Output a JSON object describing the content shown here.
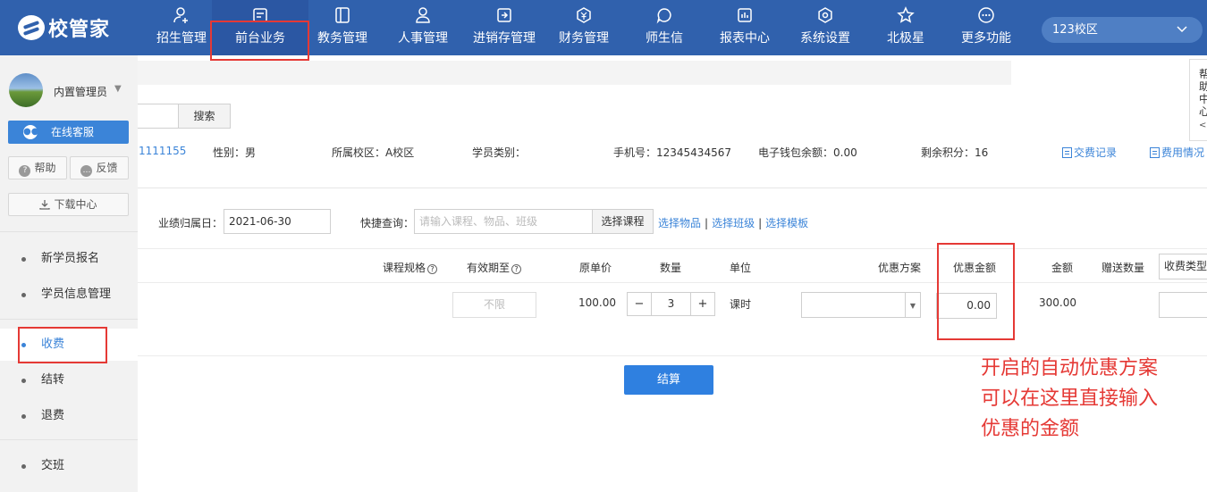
{
  "brand": {
    "logo_text": "校管家"
  },
  "nav": [
    {
      "label": "招生管理",
      "icon": "person-add-icon"
    },
    {
      "label": "前台业务",
      "icon": "front-desk-icon"
    },
    {
      "label": "教务管理",
      "icon": "book-icon"
    },
    {
      "label": "人事管理",
      "icon": "person-icon"
    },
    {
      "label": "进销存管理",
      "icon": "inventory-icon"
    },
    {
      "label": "财务管理",
      "icon": "yuan-icon"
    },
    {
      "label": "师生信",
      "icon": "chat-icon"
    },
    {
      "label": "报表中心",
      "icon": "report-icon"
    },
    {
      "label": "系统设置",
      "icon": "settings-icon"
    },
    {
      "label": "北极星",
      "icon": "star-icon"
    },
    {
      "label": "更多功能",
      "icon": "more-icon"
    }
  ],
  "campus_select": {
    "value": "123校区"
  },
  "sidebar": {
    "user_name": "内置管理员",
    "service_label": "在线客服",
    "help_label": "帮助",
    "feedback_label": "反馈",
    "download_label": "下载中心",
    "menu": [
      "新学员报名",
      "学员信息管理",
      "收费",
      "结转",
      "退费",
      "交班"
    ],
    "active_menu": "收费"
  },
  "search": {
    "button_label": "搜索"
  },
  "student": {
    "id_fragment": "1111155",
    "gender": "性别：男",
    "campus": "所属校区：A校区",
    "category": "学员类别：",
    "phone": "手机号：12345434567",
    "wallet": "电子钱包余额：0.00",
    "points": "剩余积分：16",
    "payment_record_link": "交费记录",
    "fee_info_link": "费用情况"
  },
  "form": {
    "performance_date_label": "业绩归属日：",
    "performance_date": "2021-06-30",
    "quick_query_label": "快捷查询：",
    "quick_query_placeholder": "请输入课程、物品、班级",
    "select_course": "选择课程",
    "select_item": "选择物品",
    "select_class": "选择班级",
    "select_template": "选择模板"
  },
  "table": {
    "headers": {
      "spec": "课程规格",
      "valid_until": "有效期至",
      "unit_price": "原单价",
      "quantity": "数量",
      "unit": "单位",
      "discount_plan": "优惠方案",
      "discount_amount": "优惠金额",
      "amount": "金额",
      "gift_qty": "赠送数量",
      "fee_type": "收费类型"
    },
    "row": {
      "valid_until": "不限",
      "unit_price": "100.00",
      "quantity": "3",
      "minus": "−",
      "plus": "+",
      "unit": "课时",
      "discount_amount": "0.00",
      "amount": "300.00"
    }
  },
  "settle_label": "结算",
  "annotation": [
    "开启的自动优惠方案",
    "可以在这里直接输入",
    "优惠的金额"
  ],
  "help_panel": {
    "text": [
      "帮",
      "助",
      "中",
      "心"
    ]
  },
  "colors": {
    "topbar": "#3061ad",
    "accent": "#2f80e0",
    "annotation": "#e53935"
  }
}
